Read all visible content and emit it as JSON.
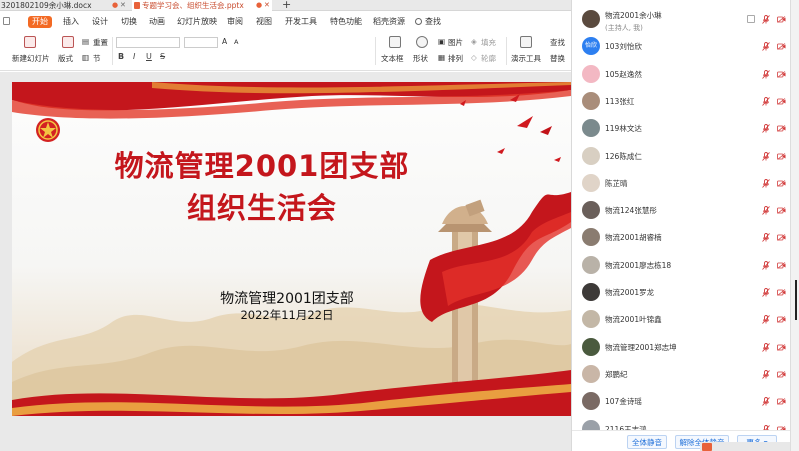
{
  "tabs": [
    {
      "label": "3201802109余小琳.docx",
      "active": false
    },
    {
      "label": "专题学习会、组织生活会.pptx",
      "active": true
    }
  ],
  "new_tab_label": "+",
  "menu": {
    "items": [
      "开始",
      "插入",
      "设计",
      "切换",
      "动画",
      "幻灯片放映",
      "审阅",
      "视图",
      "开发工具",
      "特色功能",
      "稻壳资源"
    ],
    "active_index": 0,
    "search_label": "查找"
  },
  "ribbon": {
    "new_slide": "新建幻灯片",
    "layout": "版式",
    "section": "节",
    "reset": "重置",
    "textbox": "文本框",
    "shape": "形状",
    "arrange": "排列",
    "picture": "图片",
    "fill": "填充",
    "outline": "轮廓",
    "present_tool": "演示工具",
    "find": "查找",
    "replace": "替换",
    "format_bold": "B",
    "format_italic": "I",
    "format_underline": "U",
    "format_strike": "S",
    "font_grow": "A",
    "font_shrink": "A"
  },
  "slide": {
    "title_line1": "物流管理2001团支部",
    "title_line2": "组织生活会",
    "subtitle": "物流管理2001团支部",
    "date": "2022年11月22日"
  },
  "colors": {
    "accent": "#f36a24",
    "title_red": "#c4161c",
    "link_blue": "#1e6fd9",
    "muted_red_icon": "#d23b3b"
  },
  "participants": [
    {
      "name": "物流2001余小琳",
      "role": "(主持人, 我)",
      "avatar_text": "",
      "avatar_color": "#5a4a3e"
    },
    {
      "name": "103刘怡欣",
      "role": "",
      "avatar_text": "怡欣",
      "avatar_color": "#2d7ff0"
    },
    {
      "name": "105赵逸然",
      "role": "",
      "avatar_text": "",
      "avatar_color": "#f3b8c3"
    },
    {
      "name": "113张红",
      "role": "",
      "avatar_text": "",
      "avatar_color": "#a98d7a"
    },
    {
      "name": "119林文达",
      "role": "",
      "avatar_text": "",
      "avatar_color": "#7b8a8d"
    },
    {
      "name": "126陈成仁",
      "role": "",
      "avatar_text": "",
      "avatar_color": "#d8cfc2"
    },
    {
      "name": "陈芷晴",
      "role": "",
      "avatar_text": "",
      "avatar_color": "#e0d4c8"
    },
    {
      "name": "物流124张慧彤",
      "role": "",
      "avatar_text": "",
      "avatar_color": "#6a5f5a"
    },
    {
      "name": "物流2001胡睿楠",
      "role": "",
      "avatar_text": "",
      "avatar_color": "#8a7c70"
    },
    {
      "name": "物流2001廖志栋18",
      "role": "",
      "avatar_text": "",
      "avatar_color": "#b9b2a8"
    },
    {
      "name": "物流2001罗龙",
      "role": "",
      "avatar_text": "",
      "avatar_color": "#3d3a38"
    },
    {
      "name": "物流2001叶锦鑫",
      "role": "",
      "avatar_text": "",
      "avatar_color": "#c3b7a6"
    },
    {
      "name": "物流管理2001郑志坤",
      "role": "",
      "avatar_text": "",
      "avatar_color": "#4a5a3e"
    },
    {
      "name": "郑鹏纪",
      "role": "",
      "avatar_text": "",
      "avatar_color": "#c9b6a7"
    },
    {
      "name": "107金诗瑶",
      "role": "",
      "avatar_text": "",
      "avatar_color": "#7a6a64"
    },
    {
      "name": "2116王志鸿",
      "role": "",
      "avatar_text": "",
      "avatar_color": "#9aa0a8"
    }
  ],
  "panel_footer": {
    "mute_all": "全体静音",
    "unmute_all": "解除全体静音",
    "more": "更多 ▾"
  }
}
